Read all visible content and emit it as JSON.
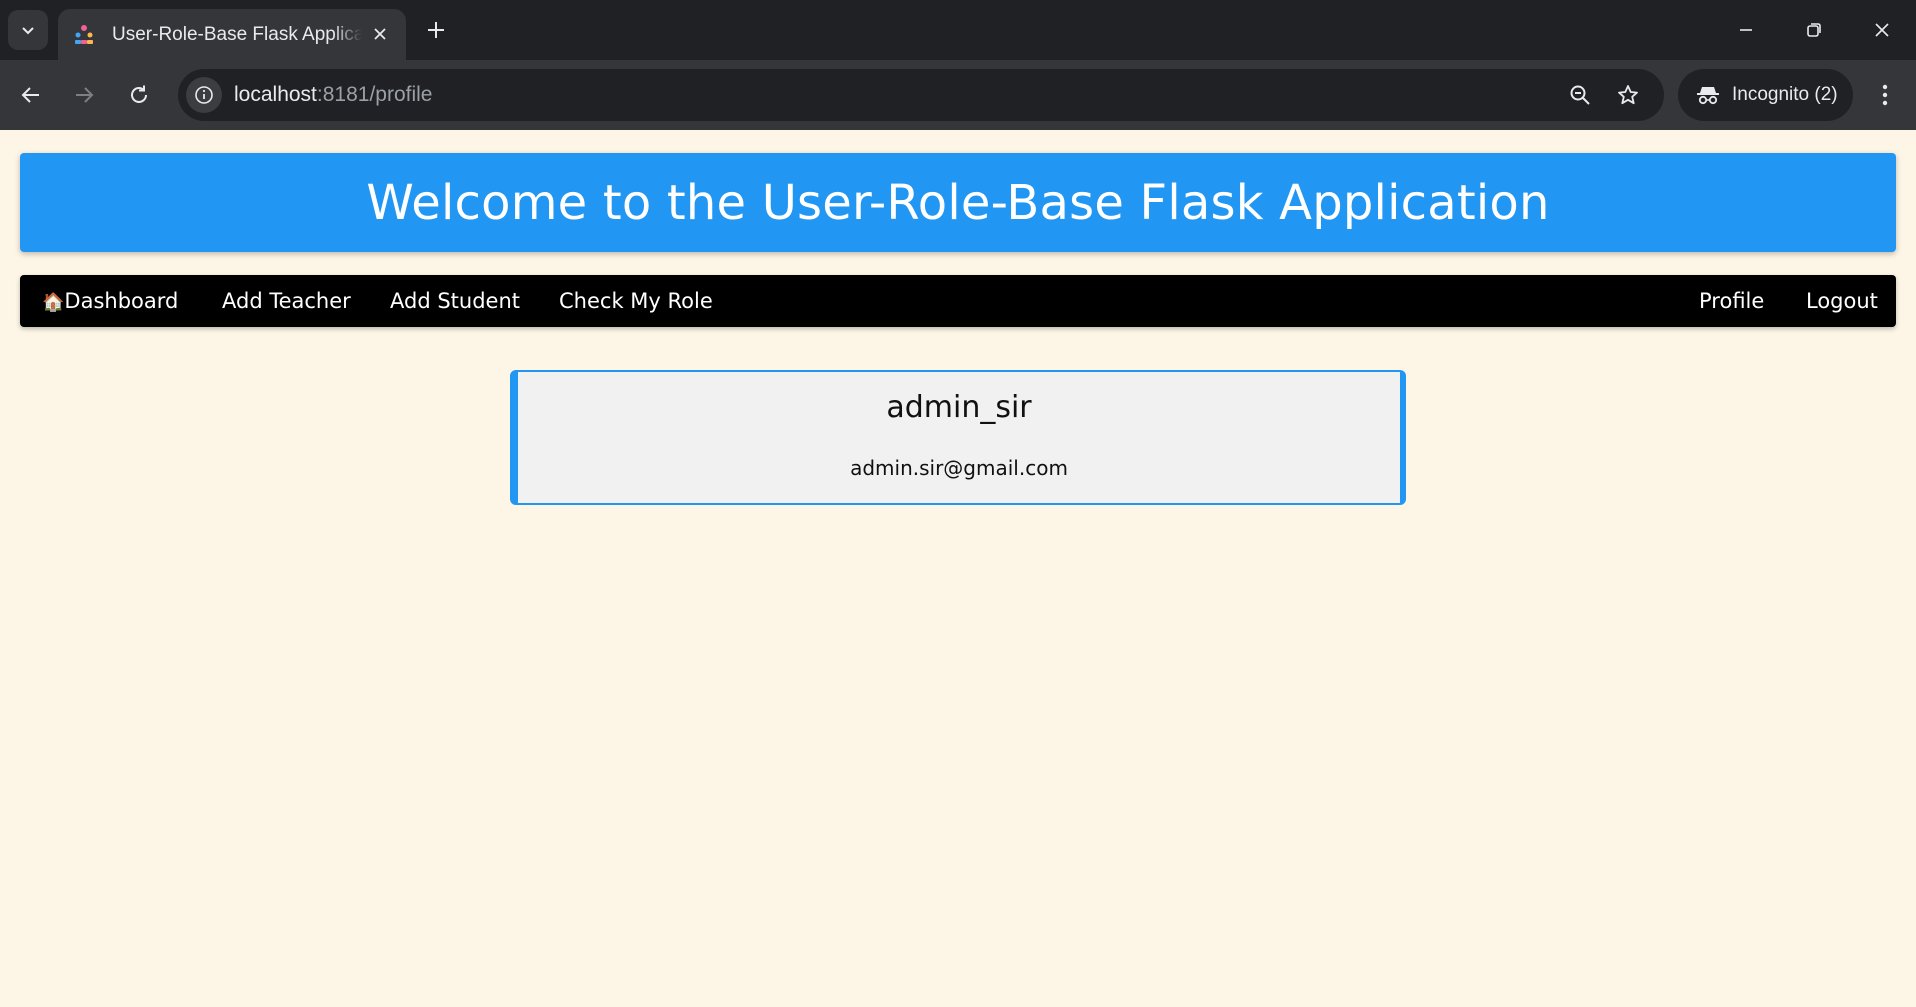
{
  "browser": {
    "tab_title": "User-Role-Base Flask Application",
    "url_host": "localhost",
    "url_rest": ":8181/profile",
    "incognito_label": "Incognito (2)"
  },
  "header": {
    "title": "Welcome to the User-Role-Base Flask Application"
  },
  "nav": {
    "dashboard_emoji": "🏠",
    "dashboard": "Dashboard",
    "add_teacher": "Add Teacher",
    "add_student": "Add Student",
    "check_role": "Check My Role",
    "profile": "Profile",
    "logout": "Logout"
  },
  "profile": {
    "username": "admin_sir",
    "email": "admin.sir@gmail.com"
  },
  "colors": {
    "header_bg": "#2196f3",
    "nav_bg": "#000000",
    "page_bg": "#fdf5e6",
    "card_bg": "#f1f1f1"
  }
}
